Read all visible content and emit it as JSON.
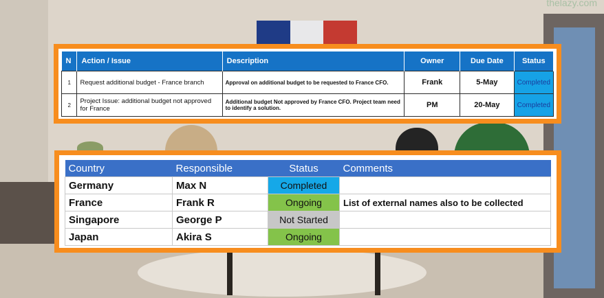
{
  "watermark": "thelazy.com",
  "flag": {
    "colors": [
      "#1f3b86",
      "#e8e8ea",
      "#c43a31"
    ]
  },
  "action_table": {
    "headers": {
      "n": "N",
      "action": "Action / Issue",
      "description": "Description",
      "owner": "Owner",
      "due": "Due Date",
      "status": "Status"
    },
    "rows": [
      {
        "n": "1",
        "action": "Request additional budget - France branch",
        "description": "Approval on additional budget to be requested to France CFO.",
        "owner": "Frank",
        "due": "5-May",
        "status": "Completed"
      },
      {
        "n": "2",
        "action": "Project Issue: additional budget not approved for France",
        "description": "Additional budget Not approved by France CFO. Project team need to identify a solution.",
        "owner": "PM",
        "due": "20-May",
        "status": "Completed"
      }
    ]
  },
  "country_table": {
    "headers": {
      "country": "Country",
      "responsible": "Responsible",
      "status": "Status",
      "comments": "Comments"
    },
    "rows": [
      {
        "country": "Germany",
        "responsible": "Max N",
        "status": "Completed",
        "comments": ""
      },
      {
        "country": "France",
        "responsible": "Frank R",
        "status": "Ongoing",
        "comments": "List of external names also to be collected"
      },
      {
        "country": "Singapore",
        "responsible": "George P",
        "status": "Not Started",
        "comments": ""
      },
      {
        "country": "Japan",
        "responsible": "Akira S",
        "status": "Ongoing",
        "comments": ""
      }
    ]
  },
  "colors": {
    "panel_border": "#f78d1e",
    "header_blue": "#1673c6",
    "completed": "#15a8e8",
    "ongoing": "#84c34a",
    "not_started": "#c7c7c7"
  }
}
